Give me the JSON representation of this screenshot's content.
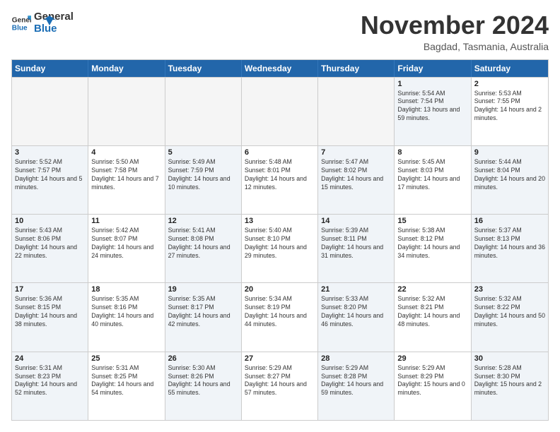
{
  "logo": {
    "line1": "General",
    "line2": "Blue"
  },
  "title": "November 2024",
  "location": "Bagdad, Tasmania, Australia",
  "days_header": [
    "Sunday",
    "Monday",
    "Tuesday",
    "Wednesday",
    "Thursday",
    "Friday",
    "Saturday"
  ],
  "rows": [
    [
      {
        "day": "",
        "info": "",
        "empty": true
      },
      {
        "day": "",
        "info": "",
        "empty": true
      },
      {
        "day": "",
        "info": "",
        "empty": true
      },
      {
        "day": "",
        "info": "",
        "empty": true
      },
      {
        "day": "",
        "info": "",
        "empty": true
      },
      {
        "day": "1",
        "info": "Sunrise: 5:54 AM\nSunset: 7:54 PM\nDaylight: 13 hours and 59 minutes.",
        "shaded": true
      },
      {
        "day": "2",
        "info": "Sunrise: 5:53 AM\nSunset: 7:55 PM\nDaylight: 14 hours and 2 minutes.",
        "shaded": false
      }
    ],
    [
      {
        "day": "3",
        "info": "Sunrise: 5:52 AM\nSunset: 7:57 PM\nDaylight: 14 hours and 5 minutes.",
        "shaded": true
      },
      {
        "day": "4",
        "info": "Sunrise: 5:50 AM\nSunset: 7:58 PM\nDaylight: 14 hours and 7 minutes.",
        "shaded": false
      },
      {
        "day": "5",
        "info": "Sunrise: 5:49 AM\nSunset: 7:59 PM\nDaylight: 14 hours and 10 minutes.",
        "shaded": true
      },
      {
        "day": "6",
        "info": "Sunrise: 5:48 AM\nSunset: 8:01 PM\nDaylight: 14 hours and 12 minutes.",
        "shaded": false
      },
      {
        "day": "7",
        "info": "Sunrise: 5:47 AM\nSunset: 8:02 PM\nDaylight: 14 hours and 15 minutes.",
        "shaded": true
      },
      {
        "day": "8",
        "info": "Sunrise: 5:45 AM\nSunset: 8:03 PM\nDaylight: 14 hours and 17 minutes.",
        "shaded": false
      },
      {
        "day": "9",
        "info": "Sunrise: 5:44 AM\nSunset: 8:04 PM\nDaylight: 14 hours and 20 minutes.",
        "shaded": true
      }
    ],
    [
      {
        "day": "10",
        "info": "Sunrise: 5:43 AM\nSunset: 8:06 PM\nDaylight: 14 hours and 22 minutes.",
        "shaded": true
      },
      {
        "day": "11",
        "info": "Sunrise: 5:42 AM\nSunset: 8:07 PM\nDaylight: 14 hours and 24 minutes.",
        "shaded": false
      },
      {
        "day": "12",
        "info": "Sunrise: 5:41 AM\nSunset: 8:08 PM\nDaylight: 14 hours and 27 minutes.",
        "shaded": true
      },
      {
        "day": "13",
        "info": "Sunrise: 5:40 AM\nSunset: 8:10 PM\nDaylight: 14 hours and 29 minutes.",
        "shaded": false
      },
      {
        "day": "14",
        "info": "Sunrise: 5:39 AM\nSunset: 8:11 PM\nDaylight: 14 hours and 31 minutes.",
        "shaded": true
      },
      {
        "day": "15",
        "info": "Sunrise: 5:38 AM\nSunset: 8:12 PM\nDaylight: 14 hours and 34 minutes.",
        "shaded": false
      },
      {
        "day": "16",
        "info": "Sunrise: 5:37 AM\nSunset: 8:13 PM\nDaylight: 14 hours and 36 minutes.",
        "shaded": true
      }
    ],
    [
      {
        "day": "17",
        "info": "Sunrise: 5:36 AM\nSunset: 8:15 PM\nDaylight: 14 hours and 38 minutes.",
        "shaded": true
      },
      {
        "day": "18",
        "info": "Sunrise: 5:35 AM\nSunset: 8:16 PM\nDaylight: 14 hours and 40 minutes.",
        "shaded": false
      },
      {
        "day": "19",
        "info": "Sunrise: 5:35 AM\nSunset: 8:17 PM\nDaylight: 14 hours and 42 minutes.",
        "shaded": true
      },
      {
        "day": "20",
        "info": "Sunrise: 5:34 AM\nSunset: 8:19 PM\nDaylight: 14 hours and 44 minutes.",
        "shaded": false
      },
      {
        "day": "21",
        "info": "Sunrise: 5:33 AM\nSunset: 8:20 PM\nDaylight: 14 hours and 46 minutes.",
        "shaded": true
      },
      {
        "day": "22",
        "info": "Sunrise: 5:32 AM\nSunset: 8:21 PM\nDaylight: 14 hours and 48 minutes.",
        "shaded": false
      },
      {
        "day": "23",
        "info": "Sunrise: 5:32 AM\nSunset: 8:22 PM\nDaylight: 14 hours and 50 minutes.",
        "shaded": true
      }
    ],
    [
      {
        "day": "24",
        "info": "Sunrise: 5:31 AM\nSunset: 8:23 PM\nDaylight: 14 hours and 52 minutes.",
        "shaded": true
      },
      {
        "day": "25",
        "info": "Sunrise: 5:31 AM\nSunset: 8:25 PM\nDaylight: 14 hours and 54 minutes.",
        "shaded": false
      },
      {
        "day": "26",
        "info": "Sunrise: 5:30 AM\nSunset: 8:26 PM\nDaylight: 14 hours and 55 minutes.",
        "shaded": true
      },
      {
        "day": "27",
        "info": "Sunrise: 5:29 AM\nSunset: 8:27 PM\nDaylight: 14 hours and 57 minutes.",
        "shaded": false
      },
      {
        "day": "28",
        "info": "Sunrise: 5:29 AM\nSunset: 8:28 PM\nDaylight: 14 hours and 59 minutes.",
        "shaded": true
      },
      {
        "day": "29",
        "info": "Sunrise: 5:29 AM\nSunset: 8:29 PM\nDaylight: 15 hours and 0 minutes.",
        "shaded": false
      },
      {
        "day": "30",
        "info": "Sunrise: 5:28 AM\nSunset: 8:30 PM\nDaylight: 15 hours and 2 minutes.",
        "shaded": true
      }
    ]
  ]
}
